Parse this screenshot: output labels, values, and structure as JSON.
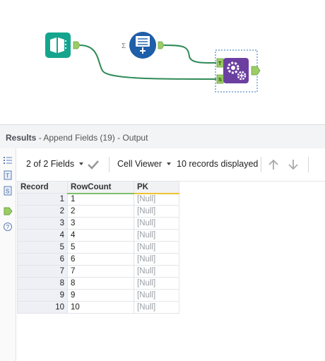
{
  "canvas": {
    "connections": [
      "connection-input-to-append-source",
      "connection-generator-to-append-target"
    ],
    "tools": {
      "input": {
        "icon": "book-input-icon",
        "color": "#15a58e"
      },
      "generate_rows": {
        "icon": "generate-rows-icon",
        "color": "#1f5ea8",
        "anchor_label": "Σ"
      },
      "append_fields": {
        "icon": "gears-icon",
        "color": "#6b3fa0",
        "target_label": "T",
        "source_label": "S"
      }
    },
    "connection_color": "#2e8b57",
    "anchor_color": "#9ccc65"
  },
  "results": {
    "title": "Results",
    "subtitle": " - Append Fields (19) - Output"
  },
  "toolbar": {
    "fields_selector": "2 of 2 Fields",
    "viewer_selector": "Cell Viewer",
    "records_status": "10 records displayed"
  },
  "grid": {
    "headers": [
      "Record",
      "RowCount",
      "PK"
    ],
    "rows": [
      [
        "1",
        "1",
        "[Null]"
      ],
      [
        "2",
        "2",
        "[Null]"
      ],
      [
        "3",
        "3",
        "[Null]"
      ],
      [
        "4",
        "4",
        "[Null]"
      ],
      [
        "5",
        "5",
        "[Null]"
      ],
      [
        "6",
        "6",
        "[Null]"
      ],
      [
        "7",
        "7",
        "[Null]"
      ],
      [
        "8",
        "8",
        "[Null]"
      ],
      [
        "9",
        "9",
        "[Null]"
      ],
      [
        "10",
        "10",
        "[Null]"
      ]
    ]
  },
  "side_rail": {
    "icons": [
      "list-icon",
      "target-anchor-icon",
      "source-anchor-icon",
      "output-anchor-icon",
      "help-icon"
    ],
    "labels": {
      "target": "T",
      "source": "S",
      "help": "?"
    }
  }
}
